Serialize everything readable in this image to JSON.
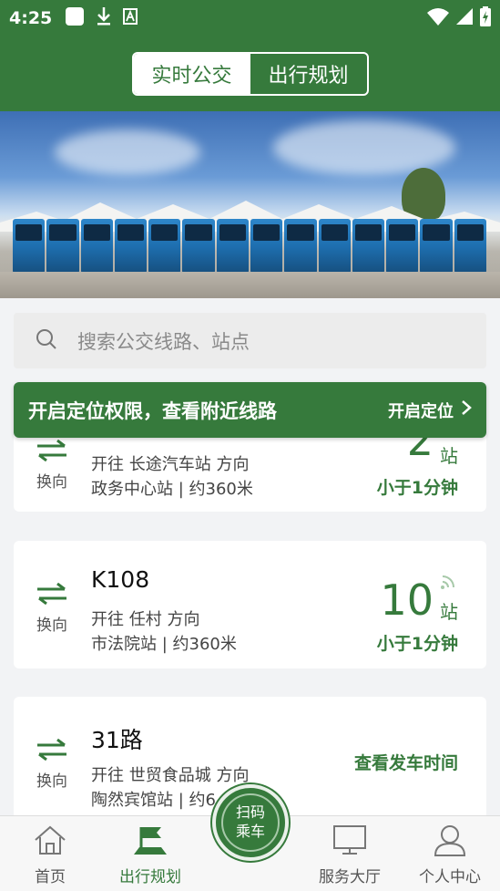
{
  "status_bar": {
    "time": "4:25",
    "icons": [
      "square-icon",
      "download-icon",
      "a-icon"
    ],
    "right_icons": [
      "wifi-icon",
      "signal-icon",
      "battery-icon"
    ]
  },
  "header": {
    "tabs": [
      {
        "label": "实时公交",
        "active": true
      },
      {
        "label": "出行规划",
        "active": false
      }
    ]
  },
  "search": {
    "placeholder": "搜索公交线路、站点"
  },
  "location_bar": {
    "message": "开启定位权限，查看附近线路",
    "action": "开启定位"
  },
  "routes": [
    {
      "route": "",
      "swap_label": "换向",
      "direction": "开往 长途汽车站 方向",
      "stop": "政务中心站 | 约360米",
      "eta_stops": "2",
      "eta_unit": "站",
      "eta_time": "小于1分钟"
    },
    {
      "route": "K108",
      "swap_label": "换向",
      "direction": "开往 任村 方向",
      "stop": "市法院站 | 约360米",
      "eta_stops": "10",
      "eta_unit": "站",
      "eta_time": "小于1分钟"
    },
    {
      "route": "31路",
      "swap_label": "换向",
      "direction": "开往 世贸食品城 方向",
      "stop": "陶然宾馆站 | 约6",
      "depart_label": "查看发车时间"
    }
  ],
  "bottom_nav": {
    "items": [
      {
        "label": "首页",
        "icon": "home-icon",
        "active": false
      },
      {
        "label": "出行规划",
        "icon": "flag-icon",
        "active": true
      },
      {
        "label": "服务大厅",
        "icon": "monitor-icon",
        "active": false
      },
      {
        "label": "个人中心",
        "icon": "user-icon",
        "active": false
      }
    ],
    "scan": {
      "line1": "扫码",
      "line2": "乘车"
    }
  },
  "colors": {
    "brand": "#367a3c",
    "background": "#f2f3f5"
  }
}
